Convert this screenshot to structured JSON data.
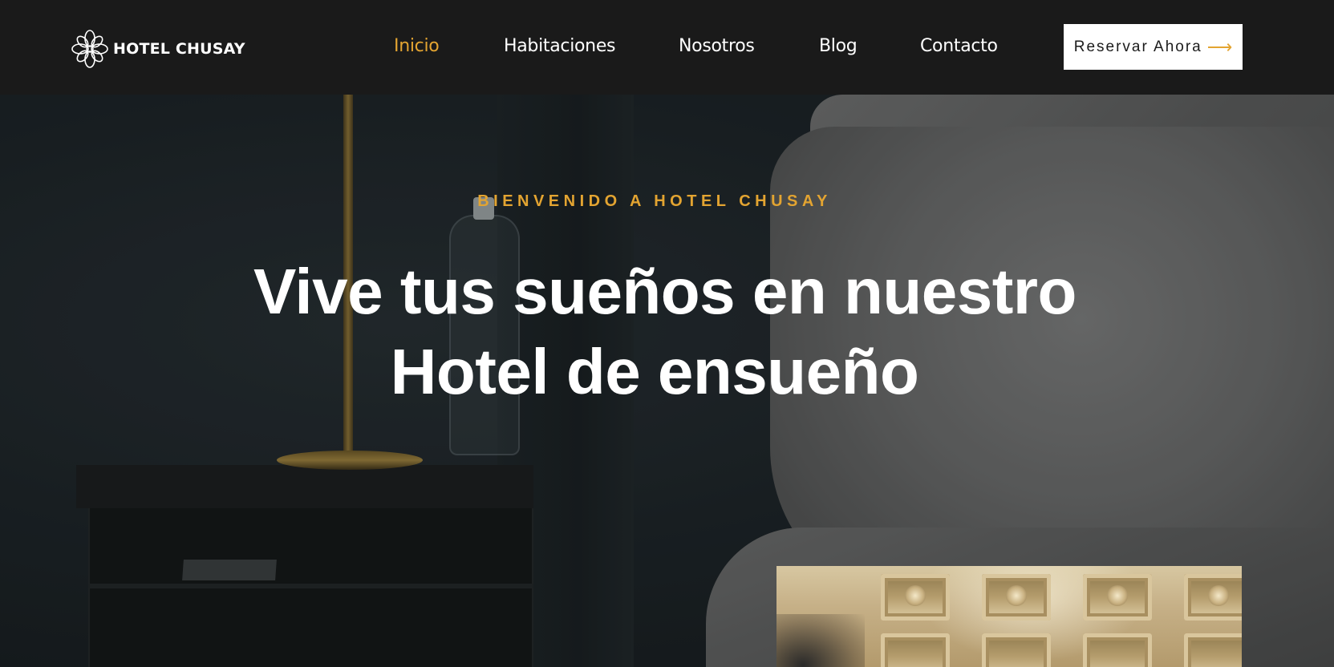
{
  "brand": {
    "name": "HOTEL CHUSAY",
    "logo_icon": "flower-ornament-icon"
  },
  "nav": {
    "items": [
      {
        "label": "Inicio",
        "active": true
      },
      {
        "label": "Habitaciones",
        "active": false
      },
      {
        "label": "Nosotros",
        "active": false
      },
      {
        "label": "Blog",
        "active": false
      },
      {
        "label": "Contacto",
        "active": false
      }
    ],
    "cta_label": "Reservar Ahora",
    "cta_icon": "arrow-right-icon"
  },
  "hero": {
    "eyebrow": "BIENVENIDO A HOTEL CHUSAY",
    "headline_line1": "Vive tus sueños en nuestro",
    "headline_line2": "Hotel de ensueño"
  },
  "colors": {
    "accent": "#e3a431",
    "header_bg": "#1a1a1a",
    "text_light": "#ffffff"
  }
}
